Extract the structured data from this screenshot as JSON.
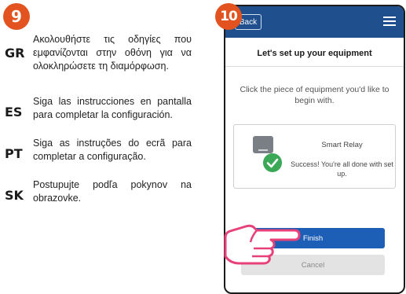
{
  "steps": {
    "left": "9",
    "right": "10"
  },
  "instructions": [
    {
      "code": "GR",
      "text": "Ακολουθήστε τις οδηγίες που εμφανίζονται στην οθόνη για να ολοκληρώσετε τη διαμόρφωση."
    },
    {
      "code": "ES",
      "text": "Siga las instrucciones en pantalla para completar la configuración."
    },
    {
      "code": "PT",
      "text": "Siga as instruções do ecrã para completar a configuração."
    },
    {
      "code": "SK",
      "text": "Postupujte podľa pokynov na obrazovke."
    }
  ],
  "phone": {
    "back_label": "Back",
    "title": "Let's set up your equipment",
    "subtitle": "Click the piece of equipment you'd like to begin with.",
    "equipment": {
      "name": "Smart Relay",
      "status": "Success! You're all done with set up."
    },
    "finish_label": "Finish",
    "cancel_label": "Cancel"
  },
  "colors": {
    "badge": "#e2531f",
    "topbar": "#1f4f8c",
    "primary_button": "#1d5fb6",
    "success": "#3aa856"
  }
}
